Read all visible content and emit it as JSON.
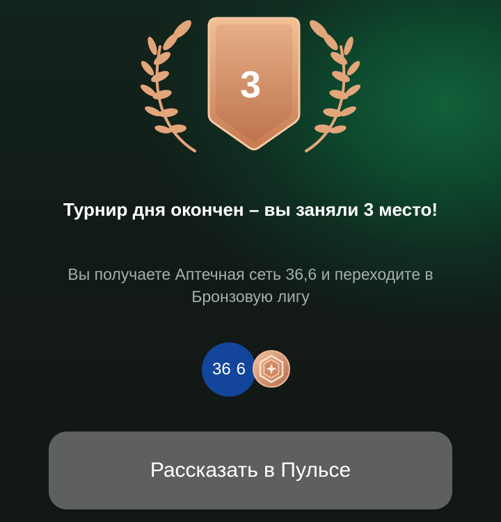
{
  "result": {
    "place": "3",
    "title": "Турнир дня окончен – вы заняли 3 место!",
    "subtitle": "Вы получаете Аптечная сеть 36,6 и переходите в Бронзовую лигу"
  },
  "rewards": {
    "pharmacy_logo_part1": "36",
    "pharmacy_logo_dot": "·",
    "pharmacy_logo_part2": "6"
  },
  "actions": {
    "share_label": "Рассказать в Пульсе"
  },
  "colors": {
    "laurel": "#e3a57a",
    "badge_top": "#f0b98c",
    "badge_bottom": "#c77e57",
    "pharmacy_blue": "#13469a",
    "pharmacy_dot": "#e6007e",
    "button_bg": "#5d605f"
  },
  "icons": {
    "place_badge": "shield-badge-icon",
    "laurel_left": "laurel-left-icon",
    "laurel_right": "laurel-right-icon",
    "league": "bronze-league-icon"
  }
}
